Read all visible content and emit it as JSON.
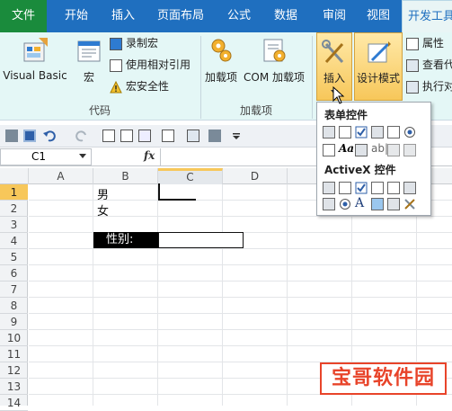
{
  "tabs": [
    "文件",
    "开始",
    "插入",
    "页面布局",
    "公式",
    "数据",
    "审阅",
    "视图",
    "开发工具"
  ],
  "active_tab": "开发工具",
  "ribbon": {
    "code_group": {
      "label": "代码",
      "visual_basic": "Visual Basic",
      "macros": "宏",
      "record_macro": "录制宏",
      "relative_ref": "使用相对引用",
      "macro_security": "宏安全性"
    },
    "addins_group": {
      "label": "加载项",
      "addins": "加载项",
      "com_addins": "COM 加载项"
    },
    "controls_group": {
      "insert": "插入",
      "design_mode": "设计模式",
      "properties": "属性",
      "view_code": "查看代",
      "run_dialog": "执行对"
    }
  },
  "formula_bar": {
    "name_box": "C1",
    "fx_label": "fx",
    "value": ""
  },
  "columns": [
    "A",
    "B",
    "C",
    "D"
  ],
  "rows": [
    "1",
    "2",
    "3",
    "4",
    "5",
    "6",
    "7",
    "8",
    "9",
    "10",
    "11",
    "12",
    "13",
    "14"
  ],
  "selected_cell": "C1",
  "cells": {
    "B1": "男",
    "B2": "女",
    "B4": "性别:"
  },
  "gallery": {
    "form_controls_title": "表单控件",
    "activex_title": "ActiveX 控件"
  },
  "watermark": "宝哥软件园",
  "colors": {
    "tab_bar": "#1f6fbf",
    "file_tab": "#1a8b3c",
    "ribbon_bg": "#e4f7f6",
    "highlight": "#f7c75a"
  }
}
